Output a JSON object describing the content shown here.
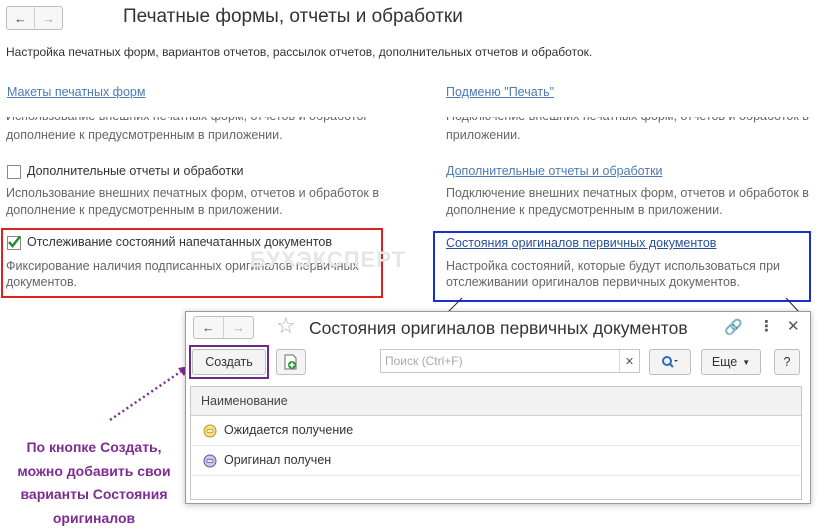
{
  "main": {
    "title": "Печатные формы, отчеты и обработки",
    "intro": "Настройка печатных форм, вариантов отчетов, рассылок отчетов, дополнительных отчетов и обработок."
  },
  "left": {
    "link1": "Макеты печатных форм",
    "desc1_cut": "Использование внешних печатных форм, отчетов и обработок в",
    "desc1_line2": "дополнение к предусмотренным в приложении.",
    "checkbox1_label": "Дополнительные отчеты и обработки",
    "checkbox1_checked": false,
    "desc2_line1": "Использование внешних печатных форм, отчетов и обработок в",
    "desc2_line2": "дополнение к предусмотренным в приложении.",
    "checkbox2_label": "Отслеживание состояний напечатанных документов",
    "checkbox2_checked": true,
    "desc3_line1": "Фиксирование наличия подписанных оригиналов первичных",
    "desc3_line2": "документов."
  },
  "right": {
    "link1": "Подменю \"Печать\"",
    "desc1_cut": "Подключение внешних печатных форм, отчетов и обработок в",
    "desc1_line2": "приложении.",
    "link2": "Дополнительные отчеты и обработки",
    "desc2_line1": "Подключение внешних печатных форм, отчетов и обработок в",
    "desc2_line2": "дополнение к предусмотренным в приложении.",
    "link3": "Состояния оригиналов первичных документов",
    "desc3_line1": "Настройка состояний, которые будут использоваться при",
    "desc3_line2": "отслеживании оригиналов первичных документов."
  },
  "watermark": "БУХЭКСПЕРТ",
  "dialog": {
    "title": "Состояния оригиналов первичных документов",
    "create_label": "Создать",
    "search_placeholder": "Поиск (Ctrl+F)",
    "more_label": "Еще",
    "help_label": "?",
    "column_header": "Наименование",
    "rows": [
      {
        "label": "Ожидается получение",
        "color": "#d4b040"
      },
      {
        "label": "Оригинал получен",
        "color": "#6a6ab0"
      }
    ]
  },
  "annotation": {
    "lines": [
      "По кнопке Создать,",
      "можно добавить свои",
      "варианты Состояния",
      "оригиналов"
    ],
    "color": "#7e2b93"
  },
  "colors": {
    "red_frame": "#e02020",
    "blue_frame": "#1a2fd0",
    "purple_frame": "#6a2a8a",
    "link": "#4c7bb5"
  }
}
